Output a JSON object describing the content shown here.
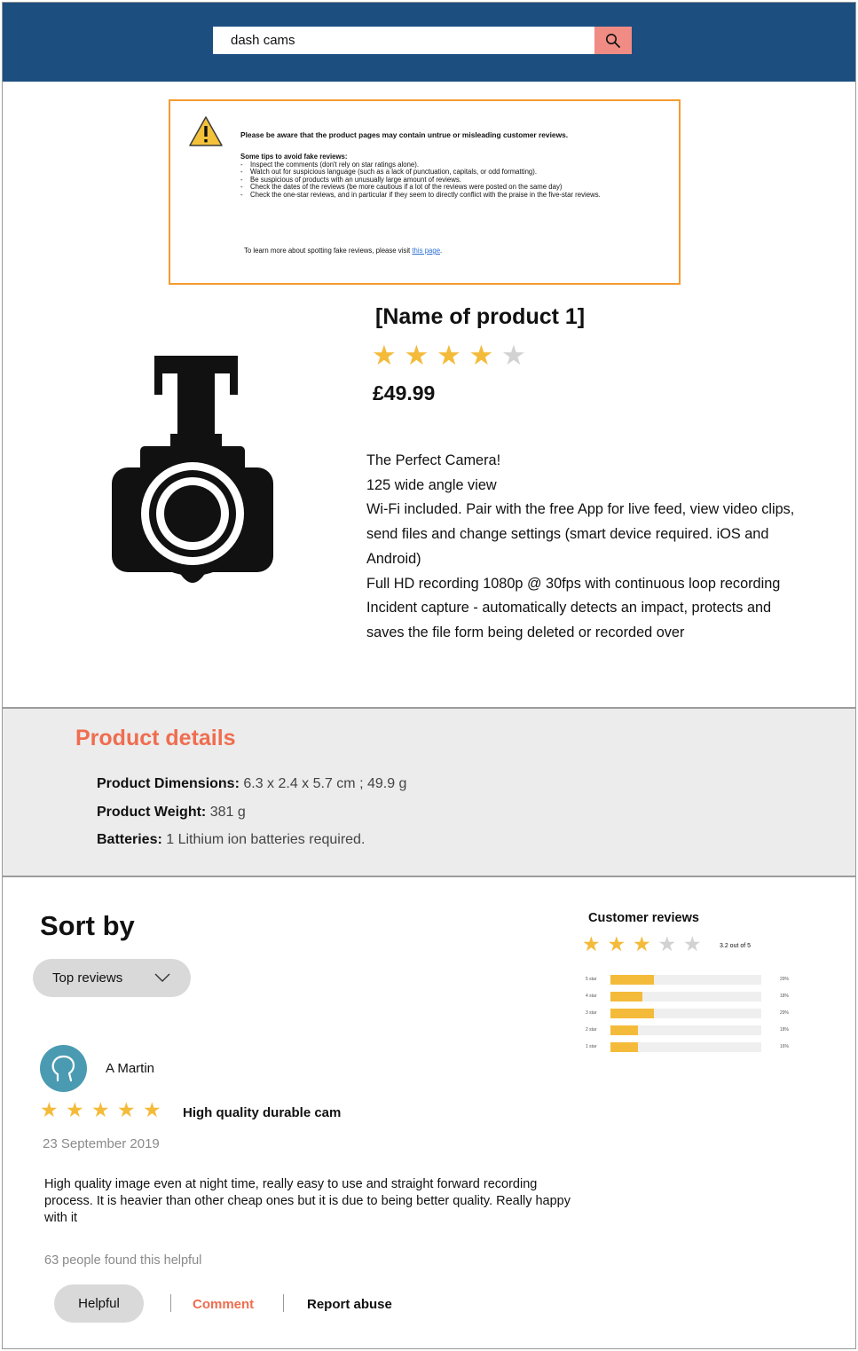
{
  "header": {
    "search_value": "dash cams",
    "search_icon": "search-icon",
    "brand_color": "#1c4e80",
    "search_button_color": "#f08c84"
  },
  "warning": {
    "icon": "warning-icon",
    "heading": "Please be aware that the product pages may contain untrue or misleading customer reviews.",
    "tips_title": "Some tips to avoid fake reviews:",
    "tips": [
      "Inspect the comments (don't rely on star ratings alone).",
      "Watch out for suspicious language (such as a lack of punctuation, capitals, or odd formatting).",
      "Be suspicious of products with an unusually large amount of reviews.",
      "Check the dates of the reviews (be more cautious if a lot of the reviews were posted on the same day)",
      "Check the one-star reviews, and in particular if they seem to directly conflict with the praise in the five-star reviews."
    ],
    "footer_text": "To learn more about spotting fake reviews, please visit ",
    "link_text": "this page",
    "footer_end": ".",
    "border_color": "#f59b30"
  },
  "product": {
    "image_icon": "dash-camera-icon",
    "title": "[Name of product 1]",
    "rating": 4,
    "max_rating": 5,
    "price": "£49.99",
    "features": [
      "The Perfect Camera!",
      "125 wide angle view",
      "Wi-Fi included. Pair with the free App for live feed, view video clips, send files and change settings (smart device required. iOS and Android)",
      "Full HD recording 1080p @ 30fps with continuous loop recording",
      "Incident capture - automatically detects an impact, protects and saves the file form being deleted or recorded over"
    ]
  },
  "details": {
    "title": "Product details",
    "title_color": "#ef6d50",
    "rows": [
      {
        "label": "Product Dimensions:",
        "value": " 6.3 x 2.4 x 5.7 cm ; 49.9 g"
      },
      {
        "label": "Product Weight:",
        "value": " 381 g"
      },
      {
        "label": "Batteries:",
        "value": " 1 Lithium ion batteries required."
      }
    ]
  },
  "sort": {
    "title": "Sort by",
    "selected": "Top reviews",
    "chevron_icon": "chevron-down-icon"
  },
  "customer_reviews": {
    "title": "Customer reviews",
    "rating": 3,
    "max_rating": 5,
    "score_text": "3.2 out of 5",
    "histogram": [
      {
        "label": "5 star",
        "percent": 29,
        "percent_text": "29%"
      },
      {
        "label": "4 star",
        "percent": 21,
        "percent_text": "18%"
      },
      {
        "label": "3 star",
        "percent": 29,
        "percent_text": "29%"
      },
      {
        "label": "2 star",
        "percent": 18,
        "percent_text": "18%"
      },
      {
        "label": "1 star",
        "percent": 18,
        "percent_text": "16%"
      }
    ]
  },
  "review": {
    "avatar_icon": "user-avatar-icon",
    "reviewer": "A Martin",
    "rating": 5,
    "max_rating": 5,
    "title": "High quality durable cam",
    "date": "23 September 2019",
    "body": "High quality image even at night time, really easy to use and straight forward recording process. It is heavier than other cheap ones but it is due to being better quality. Really happy with it",
    "helpful_count": "63 people found this helpful",
    "helpful_label": "Helpful",
    "comment_label": "Comment",
    "report_label": "Report abuse"
  }
}
